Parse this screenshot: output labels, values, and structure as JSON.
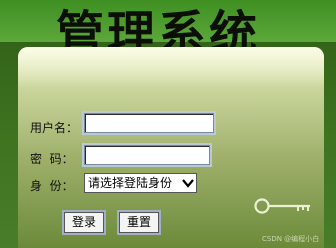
{
  "header": {
    "title": "管理系统"
  },
  "form": {
    "username_label": "用户名：",
    "username_value": "",
    "password_label": "密  码：",
    "password_value": "",
    "role_label": "身  份：",
    "role_selected": "请选择登陆身份"
  },
  "buttons": {
    "login": "登录",
    "reset": "重置"
  },
  "decor": {
    "key_icon": "key-icon",
    "watermark": "CSDN @编程小白"
  },
  "colors": {
    "page_bg": "#3e7320",
    "banner_bg": "#5ca83a",
    "panel_top": "#eef3c7",
    "panel_bottom": "#6b8a39"
  }
}
